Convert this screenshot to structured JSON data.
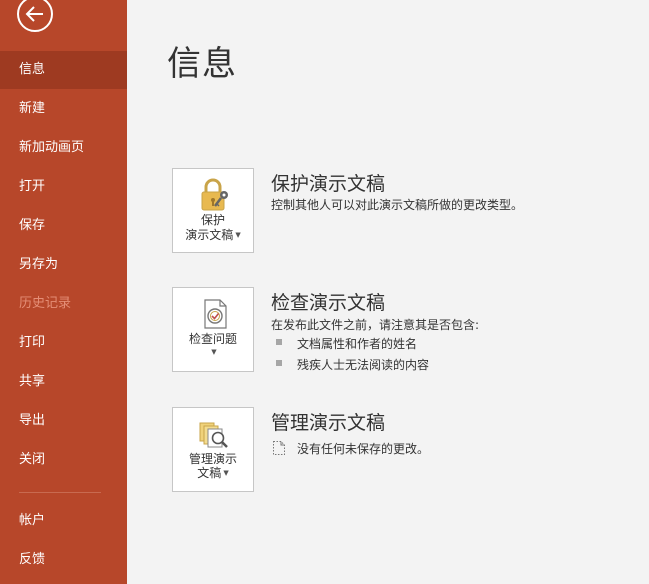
{
  "sidebar": {
    "items": [
      {
        "label": "信息",
        "state": "active"
      },
      {
        "label": "新建",
        "state": "normal"
      },
      {
        "label": "新加动画页",
        "state": "normal"
      },
      {
        "label": "打开",
        "state": "normal"
      },
      {
        "label": "保存",
        "state": "normal"
      },
      {
        "label": "另存为",
        "state": "normal"
      },
      {
        "label": "历史记录",
        "state": "disabled"
      },
      {
        "label": "打印",
        "state": "normal"
      },
      {
        "label": "共享",
        "state": "normal"
      },
      {
        "label": "导出",
        "state": "normal"
      },
      {
        "label": "关闭",
        "state": "normal"
      },
      {
        "label": "帐户",
        "state": "normal"
      },
      {
        "label": "反馈",
        "state": "normal"
      }
    ]
  },
  "main": {
    "title": "信息",
    "sections": [
      {
        "button_line1": "保护",
        "button_line2": "演示文稿",
        "icon": "lock-key-icon",
        "title": "保护演示文稿",
        "description": "控制其他人可以对此演示文稿所做的更改类型。"
      },
      {
        "button_line1": "检查问题",
        "icon": "inspect-document-icon",
        "title": "检查演示文稿",
        "description": "在发布此文件之前，请注意其是否包含:",
        "bullets": [
          "文档属性和作者的姓名",
          "残疾人士无法阅读的内容"
        ]
      },
      {
        "button_line1": "管理演示",
        "button_line2": "文稿",
        "icon": "manage-versions-icon",
        "title": "管理演示文稿",
        "description": "没有任何未保存的更改。"
      }
    ]
  },
  "colors": {
    "sidebar_bg": "#b7472a",
    "sidebar_active": "#9e3a21",
    "sidebar_disabled_text": "#e48e76",
    "main_bg": "#f3f3f3"
  }
}
